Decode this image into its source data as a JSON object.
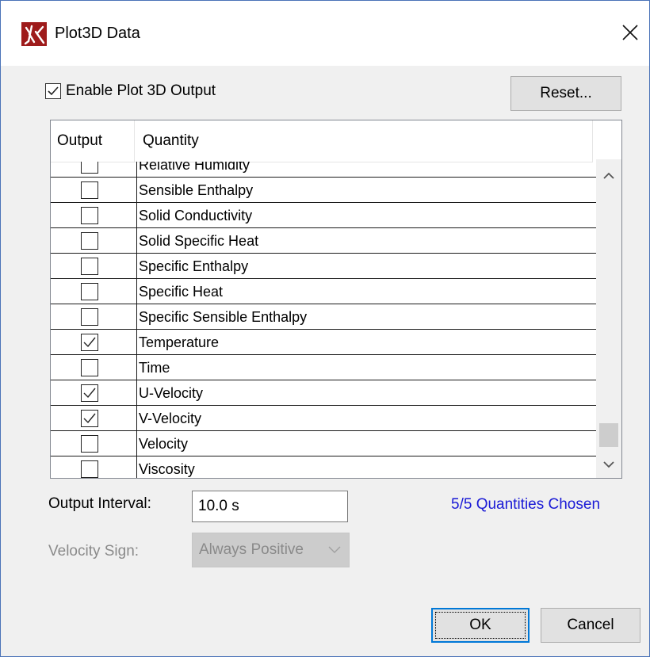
{
  "window": {
    "title": "Plot3D Data",
    "icon": "fds-flame-icon",
    "accent_color": "#9e1b1b"
  },
  "enable_output": {
    "label": "Enable Plot 3D Output",
    "checked": true
  },
  "reset_button": {
    "label": "Reset..."
  },
  "table": {
    "columns": [
      "Output",
      "Quantity"
    ],
    "rows": [
      {
        "quantity": "Relative Humidity",
        "checked": false
      },
      {
        "quantity": "Sensible Enthalpy",
        "checked": false
      },
      {
        "quantity": "Solid Conductivity",
        "checked": false
      },
      {
        "quantity": "Solid Specific Heat",
        "checked": false
      },
      {
        "quantity": "Specific Enthalpy",
        "checked": false
      },
      {
        "quantity": "Specific Heat",
        "checked": false
      },
      {
        "quantity": "Specific Sensible Enthalpy",
        "checked": false
      },
      {
        "quantity": "Temperature",
        "checked": true
      },
      {
        "quantity": "Time",
        "checked": false
      },
      {
        "quantity": "U-Velocity",
        "checked": true
      },
      {
        "quantity": "V-Velocity",
        "checked": true
      },
      {
        "quantity": "Velocity",
        "checked": false
      },
      {
        "quantity": "Viscosity",
        "checked": false
      }
    ]
  },
  "output_interval": {
    "label": "Output Interval:",
    "value": "10.0 s"
  },
  "quantities_chosen": {
    "text": "5/5 Quantities Chosen",
    "color": "#1a1ad6"
  },
  "velocity_sign": {
    "label": "Velocity Sign:",
    "value": "Always Positive",
    "disabled": true
  },
  "buttons": {
    "ok": "OK",
    "cancel": "Cancel"
  }
}
